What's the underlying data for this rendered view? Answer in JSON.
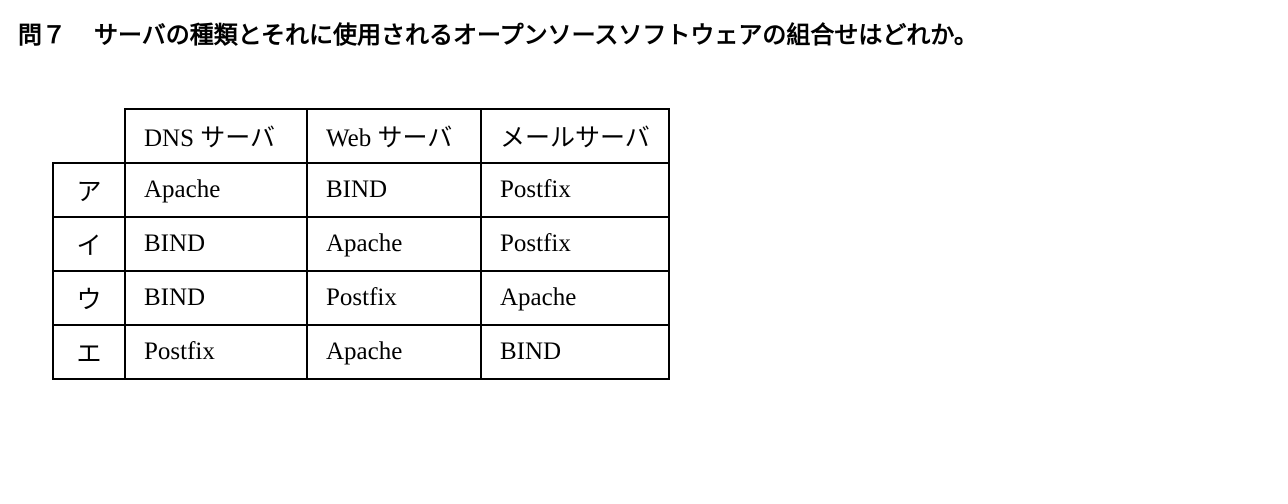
{
  "question": {
    "number": "問７",
    "text": "サーバの種類とそれに使用されるオープンソースソフトウェアの組合せはどれか。"
  },
  "table": {
    "headers": [
      "DNS サーバ",
      "Web サーバ",
      "メールサーバ"
    ],
    "rows": [
      {
        "option": "ア",
        "cells": [
          "Apache",
          "BIND",
          "Postfix"
        ]
      },
      {
        "option": "イ",
        "cells": [
          "BIND",
          "Apache",
          "Postfix"
        ]
      },
      {
        "option": "ウ",
        "cells": [
          "BIND",
          "Postfix",
          "Apache"
        ]
      },
      {
        "option": "エ",
        "cells": [
          "Postfix",
          "Apache",
          "BIND"
        ]
      }
    ]
  }
}
